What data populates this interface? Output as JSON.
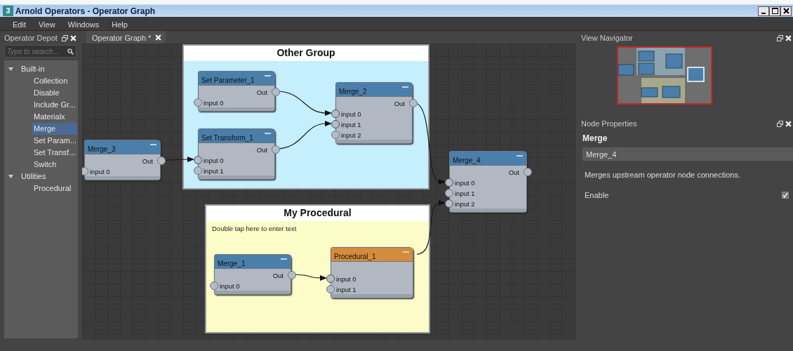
{
  "window": {
    "title": "Arnold Operators - Operator Graph",
    "icon_text": "3"
  },
  "menu": [
    "Edit",
    "View",
    "Windows",
    "Help"
  ],
  "operator_depot": {
    "title": "Operator Depot",
    "search": {
      "placeholder": "Type to search..."
    },
    "tree": [
      {
        "label": "Built-in",
        "expanded": true,
        "selected": false,
        "children": [
          {
            "label": "Collection",
            "selected": false
          },
          {
            "label": "Disable",
            "selected": false
          },
          {
            "label": "Include Gr...",
            "selected": false
          },
          {
            "label": "Materialx",
            "selected": false
          },
          {
            "label": "Merge",
            "selected": true
          },
          {
            "label": "Set Param...",
            "selected": false
          },
          {
            "label": "Set Transf...",
            "selected": false
          },
          {
            "label": "Switch",
            "selected": false
          }
        ]
      },
      {
        "label": "Utilities",
        "expanded": true,
        "selected": false,
        "children": [
          {
            "label": "Procedural",
            "selected": false
          }
        ]
      }
    ]
  },
  "graph_tab": {
    "label": "Operator Graph *"
  },
  "groups": [
    {
      "title": "Other Group",
      "color": "#c6effd"
    },
    {
      "title": "My Procedural",
      "color": "#fbfcc8",
      "note": "Double tap here to enter text"
    }
  ],
  "nodes": [
    {
      "label": "Merge_3",
      "color": "#4a7fab",
      "output": "Out",
      "inputs": [
        {
          "label": "input 0",
          "connected": false
        }
      ]
    },
    {
      "label": "Set Parameter_1",
      "color": "#4a7fab",
      "output": "Out",
      "inputs": [
        {
          "label": "input 0",
          "connected": false
        }
      ]
    },
    {
      "label": "Set Transform_1",
      "color": "#4a7fab",
      "output": "Out",
      "inputs": [
        {
          "label": "input 0",
          "connected": true
        },
        {
          "label": "input 1",
          "connected": false
        }
      ]
    },
    {
      "label": "Merge_2",
      "color": "#4a7fab",
      "output": "Out",
      "inputs": [
        {
          "label": "input 0",
          "connected": true
        },
        {
          "label": "input 1",
          "connected": true
        },
        {
          "label": "input 2",
          "connected": false
        }
      ]
    },
    {
      "label": "Merge_4",
      "color": "#4a7fab",
      "output": "Out",
      "inputs": [
        {
          "label": "input 0",
          "connected": true
        },
        {
          "label": "input 1",
          "connected": false
        },
        {
          "label": "input 2",
          "connected": true
        }
      ]
    },
    {
      "label": "Merge_1",
      "color": "#4a7fab",
      "output": "Out",
      "inputs": [
        {
          "label": "input 0",
          "connected": false
        }
      ]
    },
    {
      "label": "Procedural_1",
      "color": "#d48b3b",
      "inputs": [
        {
          "label": "input 0",
          "connected": true
        },
        {
          "label": "input 1",
          "connected": false
        }
      ]
    }
  ],
  "view_navigator": {
    "title": "View Navigator"
  },
  "node_properties": {
    "title": "Node Properties",
    "type": "Merge",
    "name": "Merge_4",
    "description": "Merges upstream operator node connections.",
    "params": [
      {
        "label": "Enable",
        "checked": true
      }
    ]
  }
}
